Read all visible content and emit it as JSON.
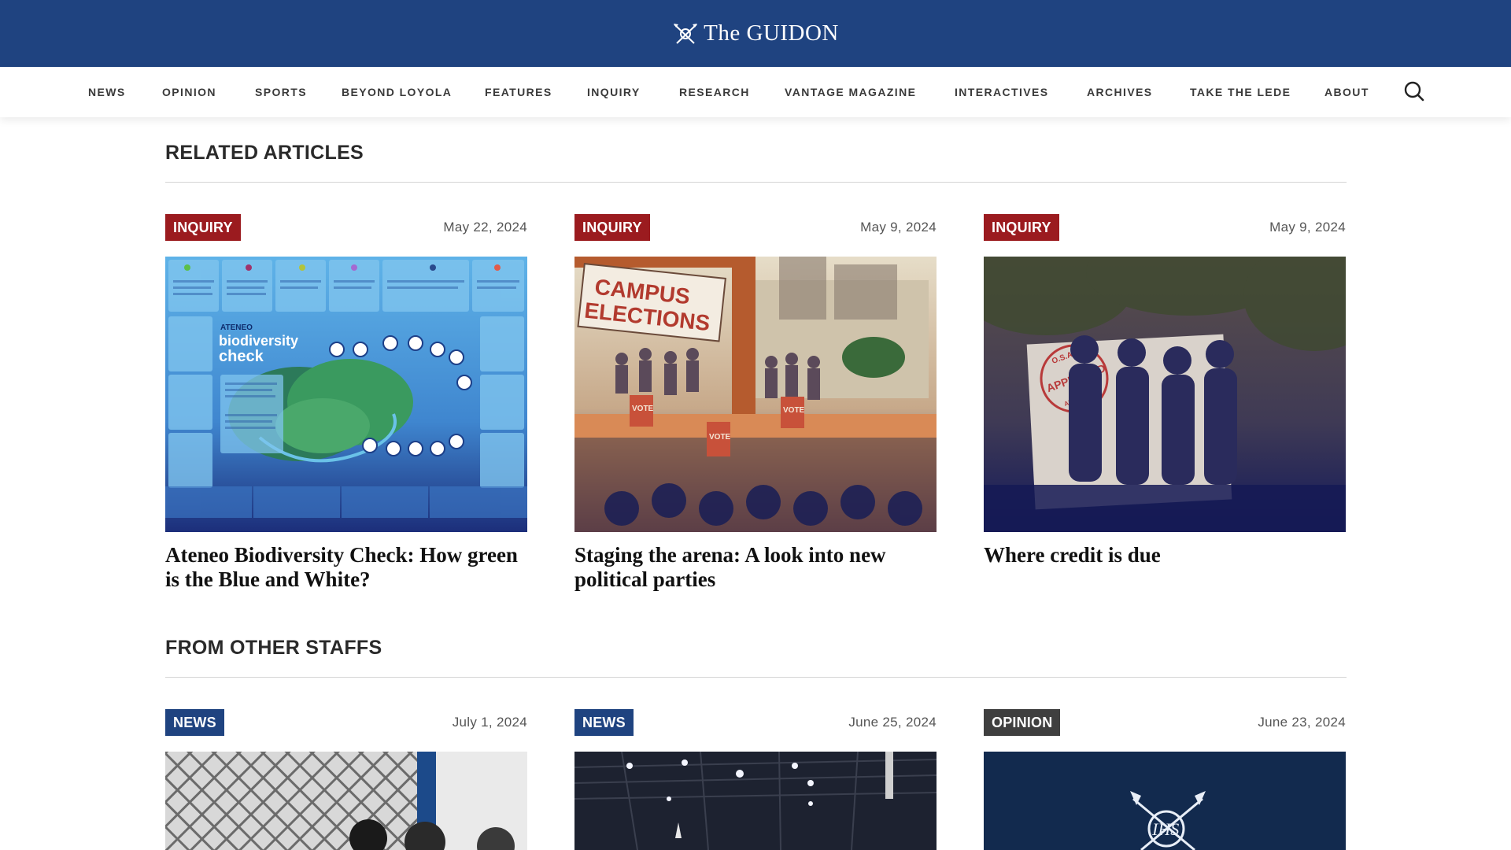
{
  "site": {
    "logo_text": "The GUIDON",
    "logo_icon": "crest-icon"
  },
  "nav": {
    "items": [
      {
        "label": "NEWS"
      },
      {
        "label": "OPINION"
      },
      {
        "label": "SPORTS"
      },
      {
        "label": "BEYOND LOYOLA"
      },
      {
        "label": "FEATURES"
      },
      {
        "label": "INQUIRY"
      },
      {
        "label": "RESEARCH"
      },
      {
        "label": "VANTAGE MAGAZINE"
      },
      {
        "label": "INTERACTIVES"
      },
      {
        "label": "ARCHIVES"
      },
      {
        "label": "TAKE THE LEDE"
      },
      {
        "label": "ABOUT"
      }
    ],
    "search_icon": "search-icon"
  },
  "related": {
    "title": "RELATED ARTICLES",
    "cards": [
      {
        "category": "INQUIRY",
        "date": "May 22, 2024",
        "title": "Ateneo Biodiversity Check: How green is the Blue and White?"
      },
      {
        "category": "INQUIRY",
        "date": "May 9, 2024",
        "title": "Staging the arena: A look into new political parties"
      },
      {
        "category": "INQUIRY",
        "date": "May 9, 2024",
        "title": "Where credit is due"
      }
    ]
  },
  "other": {
    "title": "FROM OTHER STAFFS",
    "cards": [
      {
        "category": "NEWS",
        "date": "July 1, 2024"
      },
      {
        "category": "NEWS",
        "date": "June 25, 2024"
      },
      {
        "category": "OPINION",
        "date": "June 23, 2024"
      }
    ]
  },
  "thumb_text": {
    "biodiversity_logo_top": "ATENEO",
    "biodiversity_logo_main": "biodiversity",
    "biodiversity_logo_sub": "check",
    "campus_sign_line1": "CAMPUS",
    "campus_sign_line2": "ELECTIONS",
    "vote_word": "VOTE",
    "stamp_top": "O.S.A.",
    "stamp_main": "APPROVED",
    "stamp_bottom": "APPROVED",
    "seal_text": "IHS"
  },
  "colors": {
    "brand_blue": "#1f4380",
    "inquiry_red": "#9b1b1f",
    "news_blue": "#1f4380",
    "opinion_gray": "#3f3f3f"
  }
}
